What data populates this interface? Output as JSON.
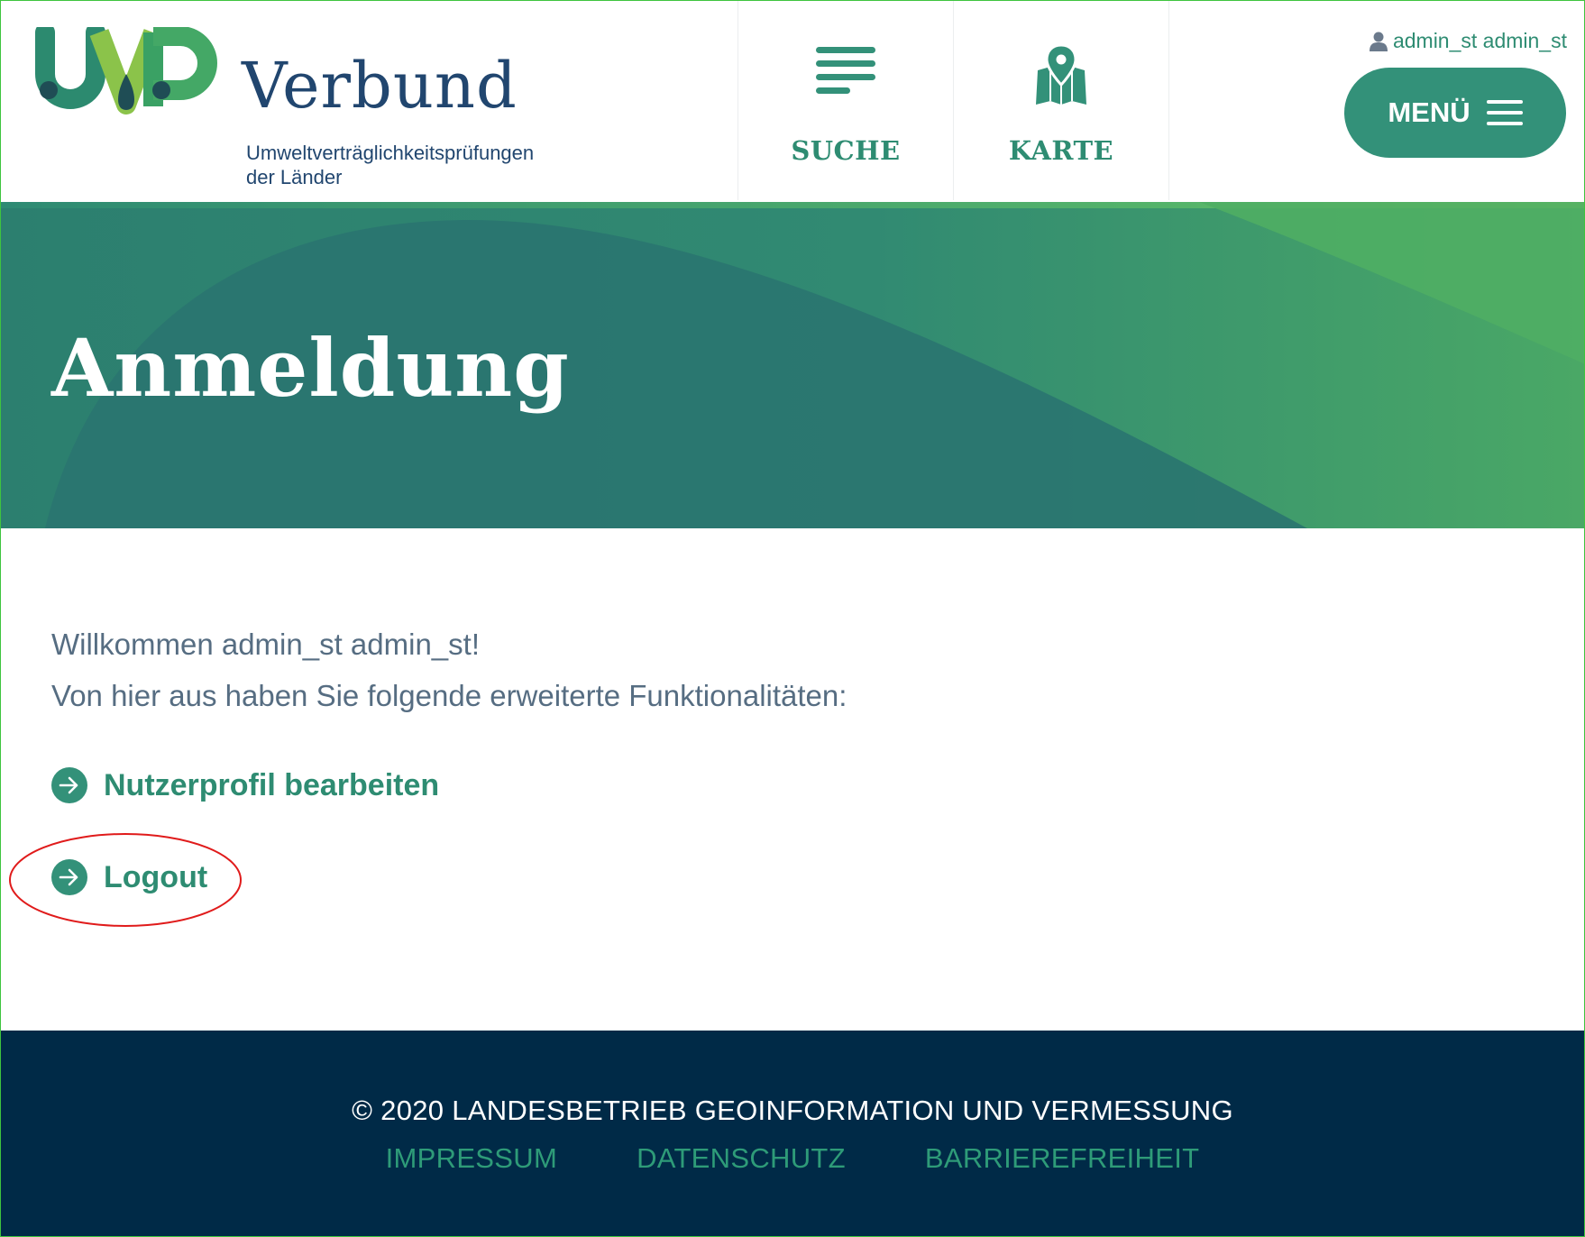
{
  "brand": {
    "logo_letters": "UVP",
    "name": "Verbund",
    "subtitle_line1": "Umweltverträglichkeitsprüfungen",
    "subtitle_line2": "der Länder"
  },
  "nav": {
    "items": [
      {
        "label": "SUCHE",
        "icon": "list-lines-icon"
      },
      {
        "label": "KARTE",
        "icon": "map-pin-icon"
      }
    ]
  },
  "user": {
    "name": "admin_st admin_st",
    "icon": "user-icon"
  },
  "menu": {
    "label": "MENÜ",
    "icon": "hamburger-icon"
  },
  "hero": {
    "title": "Anmeldung"
  },
  "main": {
    "welcome": "Willkommen admin_st admin_st!",
    "subtext": "Von hier aus haben Sie folgende erweiterte Funktionalitäten:",
    "actions": [
      {
        "label": "Nutzerprofil bearbeiten",
        "icon": "arrow-right-circle-icon"
      },
      {
        "label": "Logout",
        "icon": "arrow-right-circle-icon"
      }
    ]
  },
  "footer": {
    "copyright": "© 2020 LANDESBETRIEB GEOINFORMATION UND VERMESSUNG",
    "links": [
      "IMPRESSUM",
      "DATENSCHUTZ",
      "BARRIEREFREIHEIT"
    ]
  },
  "colors": {
    "primary": "#339179",
    "link": "#2e8c72",
    "navy": "#21466f",
    "footer_bg": "#002a47",
    "highlight": "#e01b1b"
  }
}
